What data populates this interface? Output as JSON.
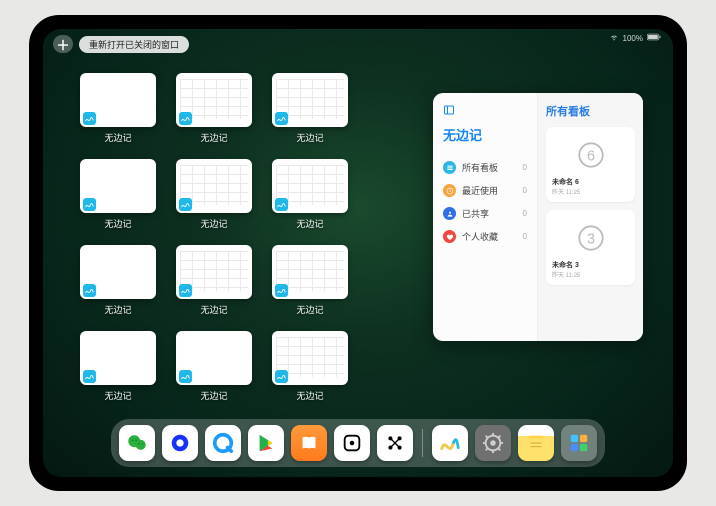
{
  "status": {
    "wifi": "wifi-icon",
    "battery": "100%"
  },
  "topbar": {
    "plus": "＋",
    "notice": "重新打开已关闭的窗口"
  },
  "app": {
    "name": "无边记",
    "panel_left_title": "无边记",
    "panel_right_title": "所有看板",
    "categories": [
      {
        "label": "所有看板",
        "count": "0",
        "color": "#2bb6e6"
      },
      {
        "label": "最近使用",
        "count": "0",
        "color": "#f7a23c"
      },
      {
        "label": "已共享",
        "count": "0",
        "color": "#2f6fe8"
      },
      {
        "label": "个人收藏",
        "count": "0",
        "color": "#f0473f"
      }
    ],
    "boards": [
      {
        "name": "未命名 6",
        "sub": "昨天 11:25",
        "digit": "6"
      },
      {
        "name": "未命名 3",
        "sub": "昨天 11:25",
        "digit": "3"
      }
    ]
  },
  "windows": [
    {
      "label": "无边记",
      "variant": "blank"
    },
    {
      "label": "无边记",
      "variant": "grid"
    },
    {
      "label": "无边记",
      "variant": "grid"
    },
    {
      "label": "无边记",
      "variant": "blank"
    },
    {
      "label": "无边记",
      "variant": "grid"
    },
    {
      "label": "无边记",
      "variant": "grid"
    },
    {
      "label": "无边记",
      "variant": "blank"
    },
    {
      "label": "无边记",
      "variant": "grid"
    },
    {
      "label": "无边记",
      "variant": "grid"
    },
    {
      "label": "无边记",
      "variant": "blank"
    },
    {
      "label": "无边记",
      "variant": "blank"
    },
    {
      "label": "无边记",
      "variant": "grid"
    }
  ],
  "dock": [
    {
      "name": "wechat",
      "bg": "#fff"
    },
    {
      "name": "quark",
      "bg": "#fff"
    },
    {
      "name": "qqbrowser",
      "bg": "#fff"
    },
    {
      "name": "play",
      "bg": "#fff"
    },
    {
      "name": "books",
      "bg": "#ff8a2b"
    },
    {
      "name": "dice",
      "bg": "#fff"
    },
    {
      "name": "dots",
      "bg": "#fff"
    },
    {
      "name": "freeform",
      "bg": "#fff"
    },
    {
      "name": "settings",
      "bg": "#6e6e6e"
    },
    {
      "name": "notes",
      "bg": "#fff"
    },
    {
      "name": "appfolder",
      "bg": "rgba(255,255,255,.3)"
    }
  ]
}
